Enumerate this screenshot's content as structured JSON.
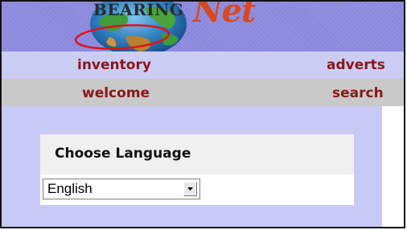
{
  "header": {
    "logo_main": "BEARING",
    "logo_script": "Net"
  },
  "nav": {
    "row1": {
      "inventory": "inventory",
      "adverts": "adverts"
    },
    "row2": {
      "welcome": "welcome",
      "search": "search"
    }
  },
  "language": {
    "title": "Choose Language",
    "selected": "English"
  },
  "colors": {
    "header_bg": "#8c8ae0",
    "nav_link": "#8b1616",
    "logo_script": "#d9481e",
    "annotation_oval": "#e3101a"
  }
}
